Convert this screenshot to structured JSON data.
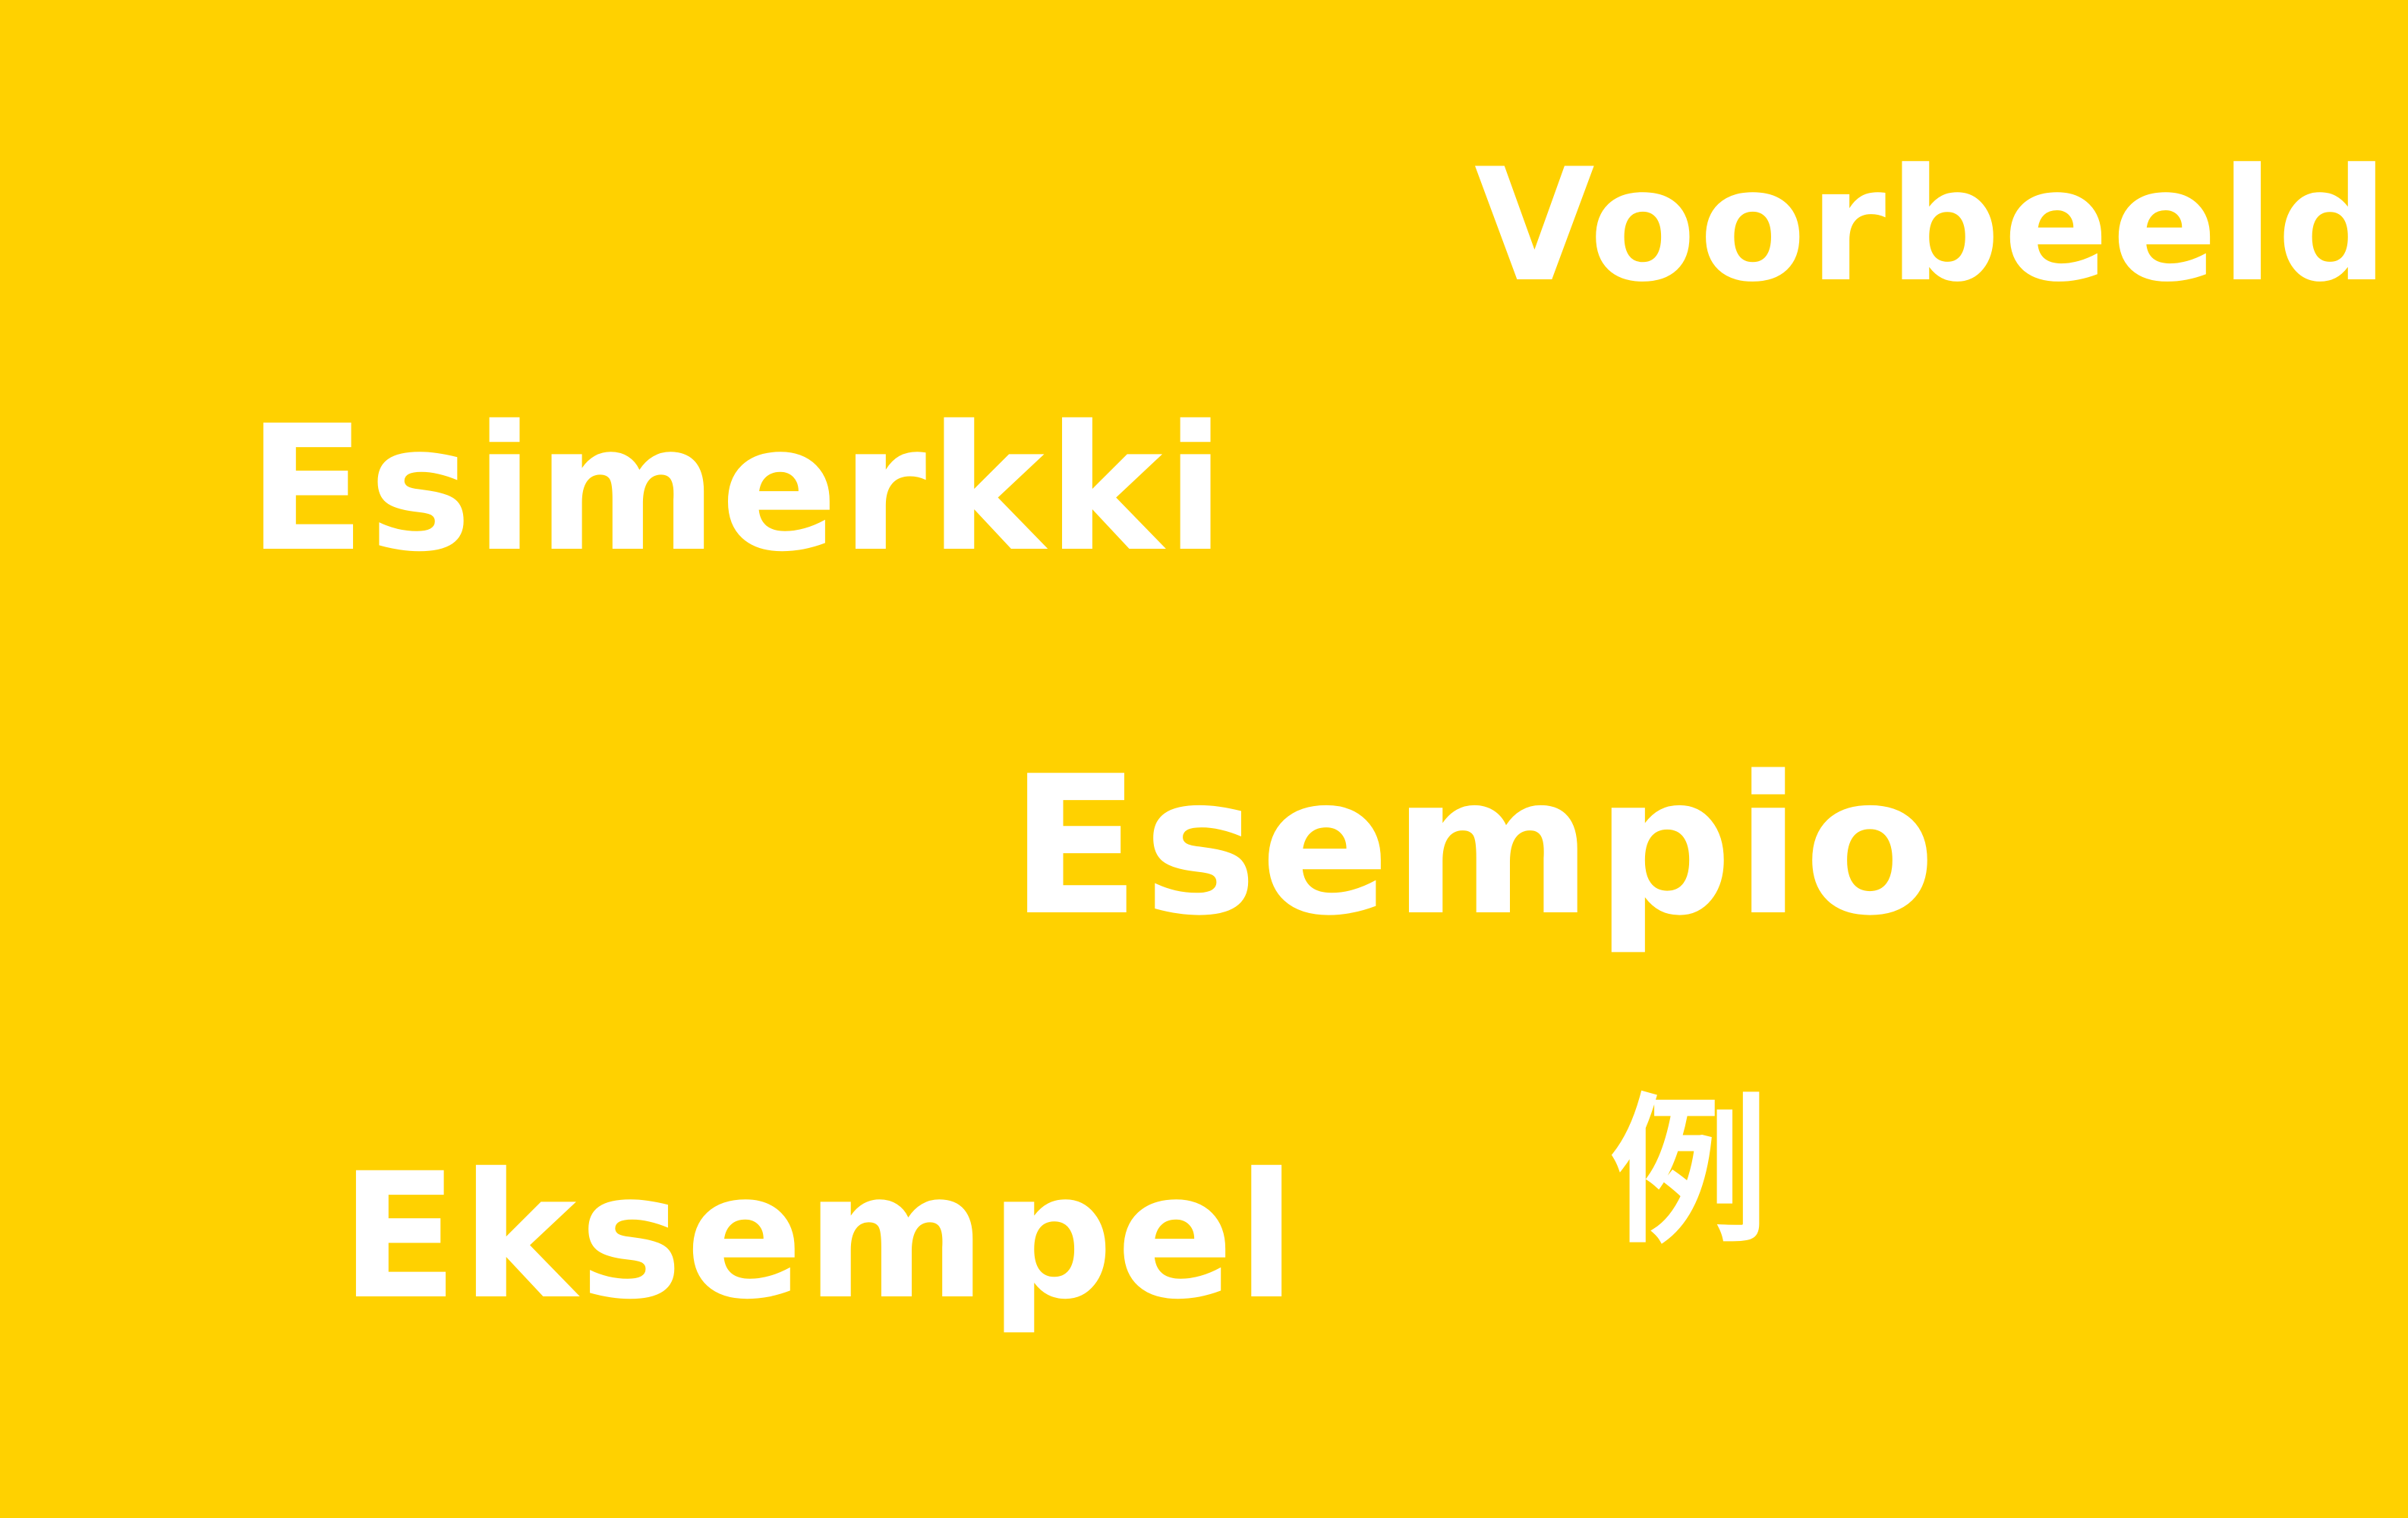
{
  "background_color": "#FFD100",
  "text_color": "#FFFFFF",
  "words": {
    "dutch": "Voorbeeld",
    "finnish": "Esimerkki",
    "italian": "Esempio",
    "danish_norwegian": "Eksempel",
    "japanese_chinese": "例"
  }
}
